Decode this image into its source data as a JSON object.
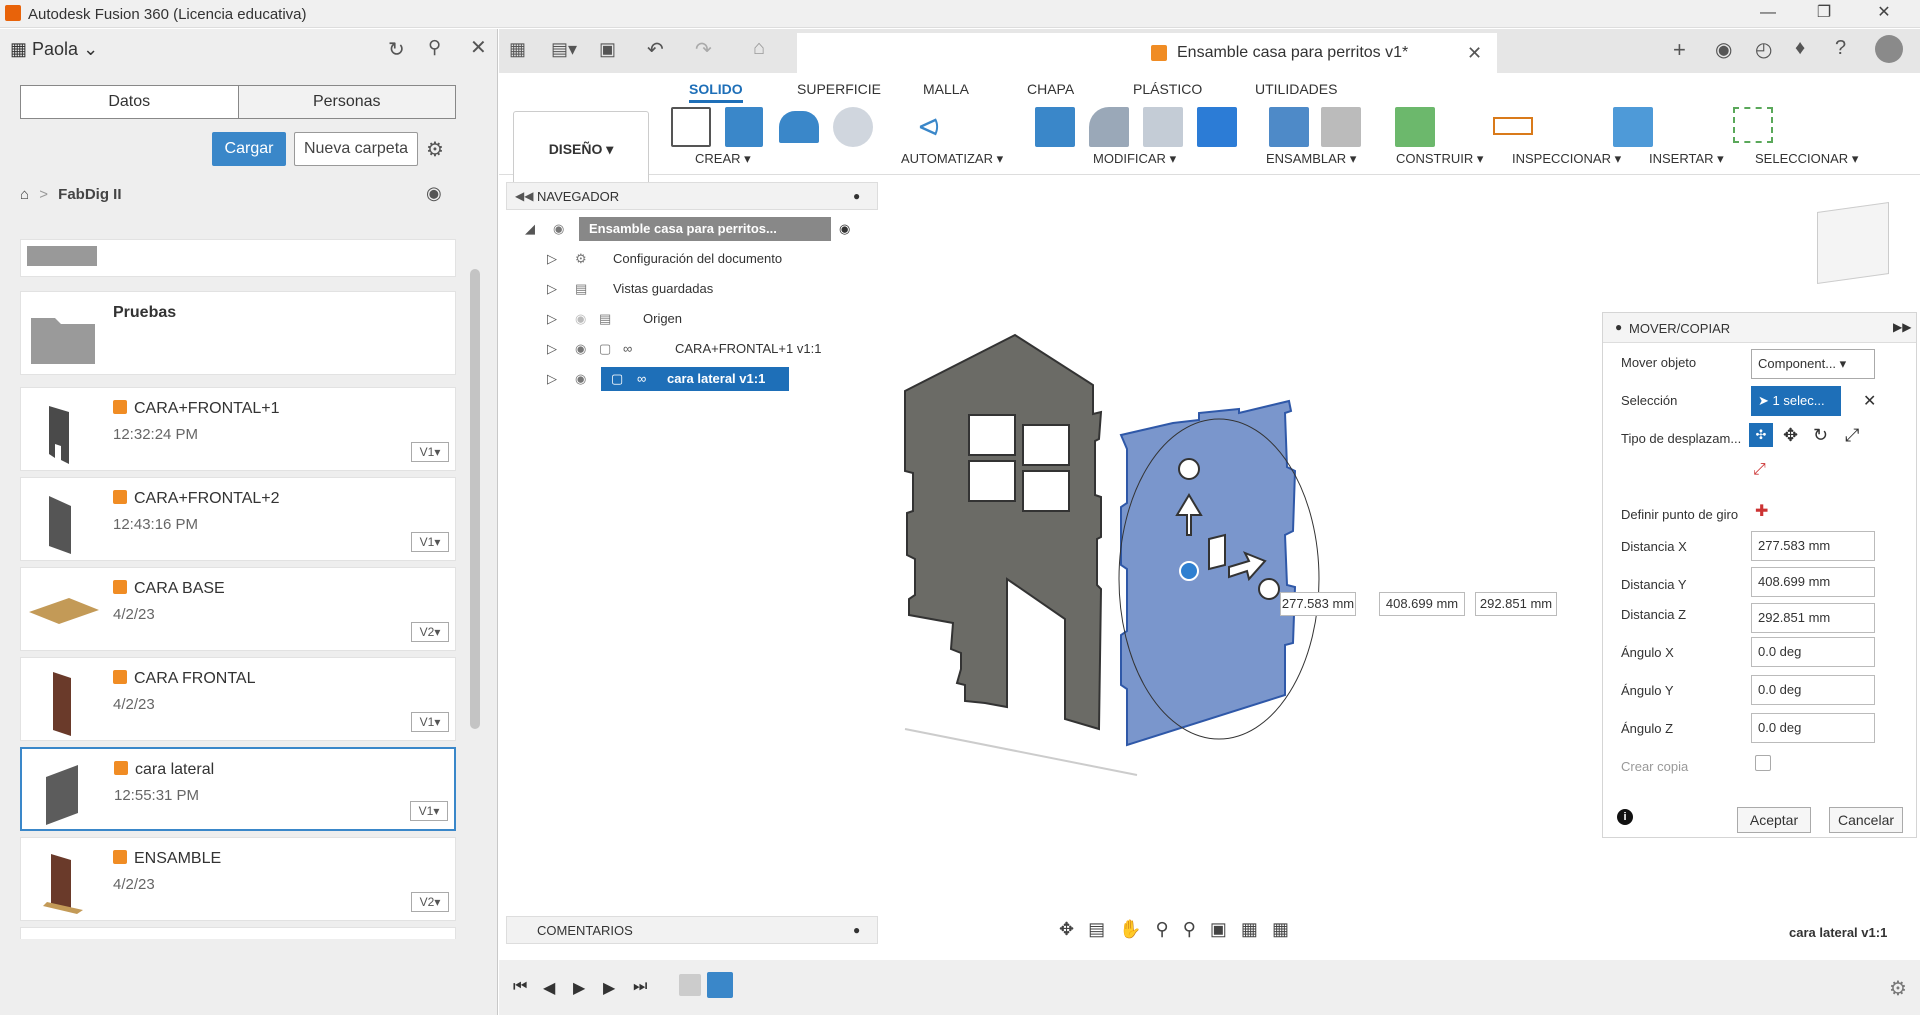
{
  "window": {
    "title": "Autodesk Fusion 360 (Licencia educativa)"
  },
  "data_panel": {
    "user": "Paola",
    "tabs": [
      "Datos",
      "Personas"
    ],
    "upload_label": "Cargar",
    "new_folder_label": "Nueva carpeta",
    "breadcrumb": "FabDig II",
    "folder": "Pruebas",
    "items": [
      {
        "name": "CARA+FRONTAL+1",
        "time": "12:32:24 PM",
        "version": "V1"
      },
      {
        "name": "CARA+FRONTAL+2",
        "time": "12:43:16 PM",
        "version": "V1"
      },
      {
        "name": "CARA BASE",
        "time": "4/2/23",
        "version": "V2"
      },
      {
        "name": "CARA FRONTAL",
        "time": "4/2/23",
        "version": "V1"
      },
      {
        "name": "cara lateral",
        "time": "12:55:31 PM",
        "version": "V1"
      },
      {
        "name": "ENSAMBLE",
        "time": "4/2/23",
        "version": "V2"
      }
    ]
  },
  "document": {
    "tab_title": "Ensamble casa para perritos v1*"
  },
  "ribbon": {
    "workspace": "DISEÑO",
    "tabs": [
      "SOLIDO",
      "SUPERFICIE",
      "MALLA",
      "CHAPA",
      "PLÁSTICO",
      "UTILIDADES"
    ],
    "groups": [
      "CREAR",
      "AUTOMATIZAR",
      "MODIFICAR",
      "ENSAMBLAR",
      "CONSTRUIR",
      "INSPECCIONAR",
      "INSERTAR",
      "SELECCIONAR"
    ]
  },
  "navigator": {
    "title": "NAVEGADOR",
    "root": "Ensamble casa para perritos...",
    "rows": [
      "Configuración del documento",
      "Vistas guardadas",
      "Origen",
      "CARA+FRONTAL+1 v1:1",
      "cara lateral v1:1"
    ]
  },
  "comments_label": "COMENTARIOS",
  "move_panel": {
    "title": "MOVER/COPIAR",
    "move_object_label": "Mover objeto",
    "move_object_value": "Component...",
    "selection_label": "Selección",
    "selection_value": "1 selec...",
    "move_type_label": "Tipo de desplazam...",
    "pivot_label": "Definir punto de giro",
    "dist_x_label": "Distancia X",
    "dist_x": "277.583 mm",
    "dist_y_label": "Distancia Y",
    "dist_y": "408.699 mm",
    "dist_z_label": "Distancia Z",
    "dist_z": "292.851 mm",
    "ang_x_label": "Ángulo X",
    "ang_x": "0.0 deg",
    "ang_y_label": "Ángulo Y",
    "ang_y": "0.0 deg",
    "ang_z_label": "Ángulo Z",
    "ang_z": "0.0 deg",
    "copy_label": "Crear copia",
    "ok_label": "Aceptar",
    "cancel_label": "Cancelar"
  },
  "viewport": {
    "dims": [
      "277.583 mm",
      "408.699 mm",
      "292.851 mm"
    ],
    "status": "cara lateral v1:1"
  }
}
